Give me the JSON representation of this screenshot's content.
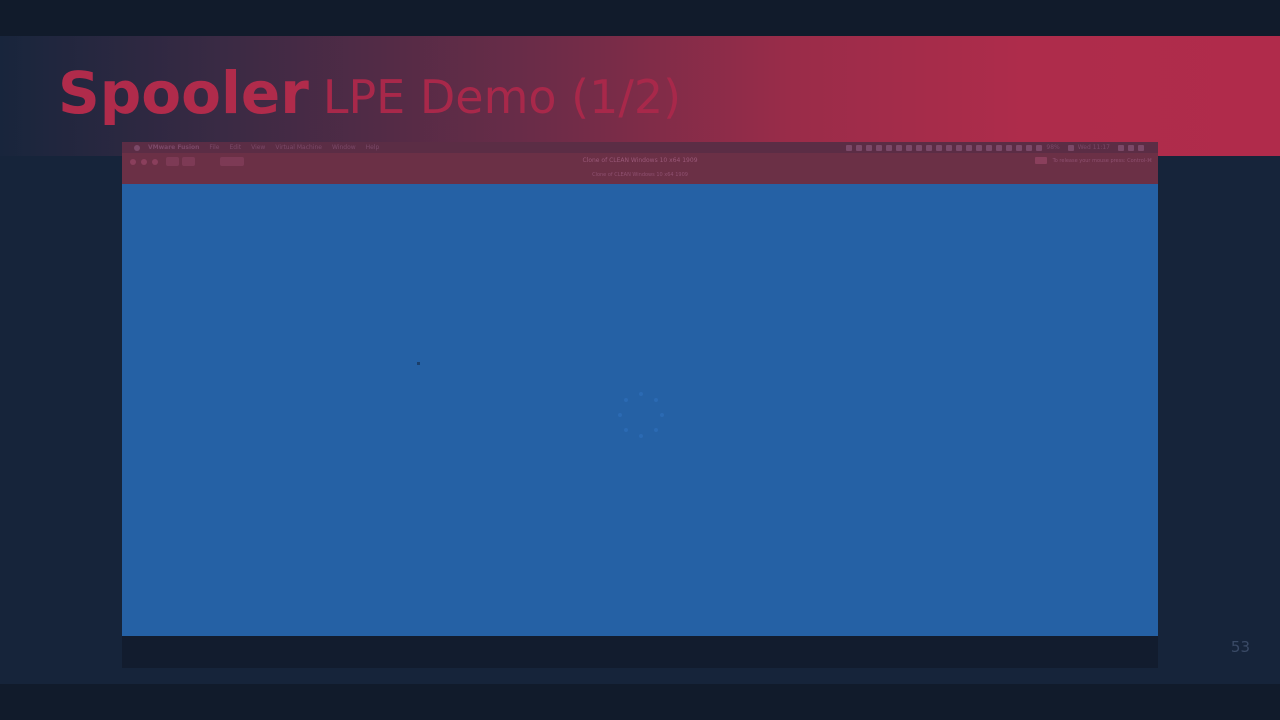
{
  "slide": {
    "title_strong": "Spooler",
    "title_light": "LPE Demo (1/2)",
    "page_number": "53"
  },
  "colors": {
    "accent": "#b02b4b",
    "slide_background": "#16243a",
    "guest_background": "#2561a5",
    "outer_background": "#111b2b"
  },
  "mac_menubar": {
    "app_name": "VMware Fusion",
    "menus": [
      "File",
      "Edit",
      "View",
      "Virtual Machine",
      "Window",
      "Help"
    ],
    "battery": "98%",
    "clock": "Wed 11:17"
  },
  "vm_window": {
    "title": "Clone of CLEAN Windows 10 x64 1909",
    "subtitle": "Clone of CLEAN Windows 10 x64 1909",
    "hint": "To release your mouse press: Control-⌘"
  },
  "guest": {
    "state": "loading"
  }
}
